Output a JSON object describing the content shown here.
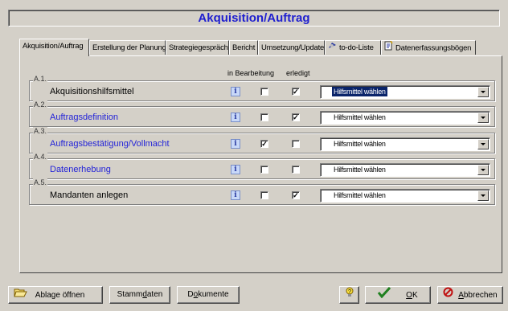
{
  "window": {
    "title": "Akquisition/Auftrag"
  },
  "tabs": [
    {
      "label": "Akquisition/Auftrag",
      "icon": "",
      "active": true
    },
    {
      "label": "Erstellung der Planung",
      "icon": "",
      "active": false
    },
    {
      "label": "Strategiegespräch",
      "icon": "",
      "active": false
    },
    {
      "label": "Bericht",
      "icon": "",
      "active": false
    },
    {
      "label": "Umsetzung/Update",
      "icon": "",
      "active": false
    },
    {
      "label": "to-do-Liste",
      "icon": "todo-list-icon",
      "active": false
    },
    {
      "label": "Datenerfassungsbögen",
      "icon": "form-sheet-icon",
      "active": false
    }
  ],
  "columns": {
    "in_progress": "in Bearbeitung",
    "done": "erledigt"
  },
  "rows": [
    {
      "code": "A.1.",
      "title": "Akquisitionshilfsmittel",
      "link": false,
      "info": "i",
      "in_progress": false,
      "done": true,
      "select": "Hilfsmittel wählen",
      "focused": true
    },
    {
      "code": "A.2.",
      "title": "Auftragsdefinition",
      "link": true,
      "info": "i",
      "in_progress": false,
      "done": true,
      "select": "Hilfsmittel wählen",
      "focused": false
    },
    {
      "code": "A.3.",
      "title": "Auftragsbestätigung/Vollmacht",
      "link": true,
      "info": "i",
      "in_progress": true,
      "done": false,
      "select": "Hilfsmittel wählen",
      "focused": false
    },
    {
      "code": "A.4.",
      "title": "Datenerhebung",
      "link": true,
      "info": "i",
      "in_progress": false,
      "done": false,
      "select": "Hilfsmittel wählen",
      "focused": false
    },
    {
      "code": "A.5.",
      "title": "Mandanten anlegen",
      "link": false,
      "info": "i",
      "in_progress": false,
      "done": true,
      "select": "Hilfsmittel wählen",
      "focused": false
    }
  ],
  "footer": {
    "open_archive": {
      "label": "Ablage öffnen",
      "icon": "open-folder-icon"
    },
    "master_data": {
      "pre": "Stamm",
      "u": "d",
      "post": "aten"
    },
    "documents": {
      "pre": "D",
      "u": "o",
      "post": "kumente"
    },
    "help": {
      "icon": "help-lightbulb-icon"
    },
    "ok": {
      "pre": "",
      "u": "O",
      "post": "K",
      "icon": "green-check-icon"
    },
    "cancel": {
      "pre": "",
      "u": "A",
      "post": "bbrechen",
      "icon": "cancel-circle-icon"
    }
  },
  "colors": {
    "title": "#1f1fcf",
    "link": "#2323d8",
    "face": "#d4d0c8",
    "selection": "#0a246a"
  }
}
